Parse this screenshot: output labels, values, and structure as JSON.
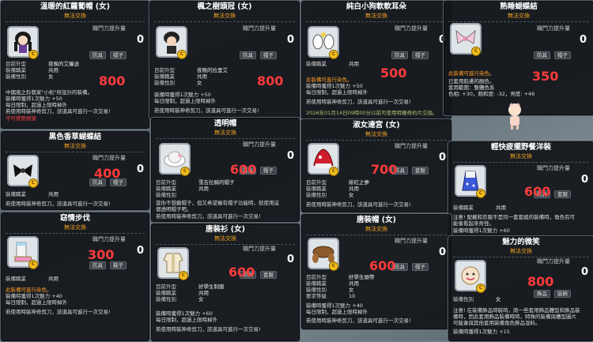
{
  "common": {
    "no_trade": "無法交換",
    "boost_label": "職門力提升量",
    "tag_defense": "防具",
    "tag_hat": "帽子",
    "tag_shoes": "鞋子",
    "tag_top": "套服",
    "tag_acc": "飾品",
    "tag_deco": "裝飾",
    "k_look": "目前外型",
    "k_job": "裝備職業",
    "k_gender": "裝備性別",
    "v_common": "共用",
    "v_female": "女",
    "coin_glyph": "C"
  },
  "cards": [
    {
      "title": "溫暖的紅蘿蔔帽 (女)",
      "boost": "0",
      "price": "800",
      "look": "夜晚的艾蘿迪",
      "job": "共用",
      "gender": "女",
      "lines": [
        "中國風之鈴我家\"小松\"所設計的裝備。",
        "裝備時獲得1次魅力 +50",
        "每日限制，超過上限時掉外",
        "若使用時裝神奇剪刀，該道具可進行一次交易!"
      ],
      "red_line": "不可使用視窗"
    },
    {
      "title": "楓之樹頭冠 (女)",
      "boost": "0",
      "price": "800",
      "look": "夜晚的拉里艾",
      "job": "共用",
      "gender": "女",
      "lines": [
        "裝備時獲得1次魅力 +50",
        "每日限制，超過上限時掉外",
        "若使用時裝神奇剪刀，該道具可進行一次交易!"
      ]
    },
    {
      "title": "純白小狗軟軟耳朵",
      "boost": "0",
      "price": "500",
      "job": "共用",
      "red_line": "此裝備可進行染色。",
      "lines": [
        "裝備時獲得1次魅力 +50",
        "每日限制，超過上限時掉外",
        "若使用時裝神奇剪刀，該道具可進行一次交易!"
      ],
      "blue_line": "2026年01月14日09時00分以前可使用特羅奇約片交換。"
    },
    {
      "title": "熟睡蝴蝶結",
      "boost": "0",
      "price": "350",
      "red_line": "此裝備可進行染色。",
      "lines": [
        "已套用肌膚的顏色。",
        "套用範圍：整體色系",
        "色相: +30，飽和度: -32，亮度: +46"
      ]
    },
    {
      "title": "黑色香草蝴蝶結",
      "boost": "0",
      "price": "400",
      "job": "共用",
      "lines": [
        "若使用時裝神奇剪刀，該道具可進行一次交易!"
      ]
    },
    {
      "title": "透明帽",
      "boost": "0",
      "price": "600",
      "look": "雪吉拉騎的帽子",
      "job": "共用",
      "gender": "",
      "lines": [
        "當你不想戴帽子，但又希望擁有帽子功能時，就使用這",
        "個透明帽子吧。",
        "若使用時裝神奇剪刀，該道具可進行一次交易!"
      ]
    },
    {
      "title": "淑女達宮 (女)",
      "boost": "0",
      "price": "700",
      "look": "緋紅之夢",
      "job": "共用",
      "gender": "女",
      "lines": [
        "若使用時裝神奇剪刀，該道具可進行一次交易!"
      ]
    },
    {
      "title": "輕快疲擺野餐洋裝",
      "boost": "0",
      "price": "600",
      "job": "共用",
      "lines": [
        "注意! 配戴和衣服不是同一套套組的裝備時，角色有可",
        "能會看起來奇怪。",
        "裝備時獲得1次魅力 +60"
      ]
    },
    {
      "title": "窈情步伐",
      "boost": "0",
      "price": "300",
      "job": "共用",
      "red_line": "此裝備可進行染色。",
      "lines": [
        "裝備時獲得1次魅力 +40",
        "每日限制，超過上限時掉外",
        "若使用時裝神奇剪刀，該道具可進行一次交易!"
      ]
    },
    {
      "title": "唐裝衫 (女)",
      "boost": "0",
      "price": "600",
      "look": "好學生制服",
      "job": "共用",
      "gender": "女",
      "lines": [
        "裝備時獲得1次魅力 +60",
        "每日限制，超過上限時掉外",
        "若使用時裝神奇剪刀，該道具可進行一次交易!"
      ]
    },
    {
      "title": "唐裝帽 (女)",
      "boost": "0",
      "price": "600",
      "look": "好學生頭帶",
      "job": "共用",
      "gender": "女",
      "lines": [
        "裝備時獲得1次魅力 +40",
        "每日限制，超過上限時掉外",
        "若使用時裝神奇剪刀，該道具可進行一次交易!"
      ],
      "extra_k": "要求等級",
      "extra_v": "10"
    },
    {
      "title": "魅力的微笑",
      "boost": "0",
      "price": "800",
      "gender": "女",
      "lines": [
        "注意! 在裝備飾品時裝時，將一些套用飾品體型和飾品裝",
        "備時，因此套用飾品裝備時時，特殊的裝備與體型圖片",
        "可能會與其他套用裝備角色飾品混料。",
        "裝備時獲得1次魅力 +15"
      ]
    }
  ]
}
